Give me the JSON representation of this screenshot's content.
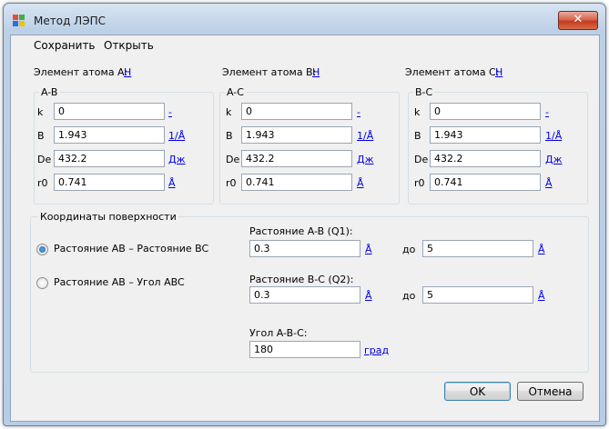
{
  "window": {
    "title": "Метод ЛЭПС",
    "close_glyph": "✕"
  },
  "menu": {
    "save": "Сохранить",
    "open": "Открыть"
  },
  "atoms": [
    {
      "element_label": "Элемент атома A:",
      "element_value": "H",
      "pair_label": "A-B",
      "k": "0",
      "k_unit": "-",
      "B": "1.943",
      "B_unit": "1/Å",
      "De": "432.2",
      "De_unit": "Дж",
      "r0": "0.741",
      "r0_unit": "Å"
    },
    {
      "element_label": "Элемент атома B:",
      "element_value": "H",
      "pair_label": "A-C",
      "k": "0",
      "k_unit": "-",
      "B": "1.943",
      "B_unit": "1/Å",
      "De": "432.2",
      "De_unit": "Дж",
      "r0": "0.741",
      "r0_unit": "Å"
    },
    {
      "element_label": "Элемент атома C:",
      "element_value": "H",
      "pair_label": "B-C",
      "k": "0",
      "k_unit": "-",
      "B": "1.943",
      "B_unit": "1/Å",
      "De": "432.2",
      "De_unit": "Дж",
      "r0": "0.741",
      "r0_unit": "Å"
    }
  ],
  "param_labels": {
    "k": "k",
    "B": "B",
    "De": "De",
    "r0": "r0"
  },
  "surface": {
    "title": "Координаты поверхности",
    "option1": "Растояние AB – Растояние BC",
    "option2": "Растояние AB – Угол ABC",
    "selected": "option1",
    "q1_label": "Растояние A-B (Q1):",
    "q1_from": "0.3",
    "q1_unit": "Å",
    "q1_to_label": "до",
    "q1_to": "5",
    "q1_to_unit": "Å",
    "q2_label": "Растояние B-C (Q2):",
    "q2_from": "0.3",
    "q2_unit": "Å",
    "q2_to_label": "до",
    "q2_to": "5",
    "q2_to_unit": "Å",
    "angle_label": "Угол A-B-C:",
    "angle_value": "180",
    "angle_unit": "град"
  },
  "buttons": {
    "ok": "OK",
    "cancel": "Отмена"
  }
}
